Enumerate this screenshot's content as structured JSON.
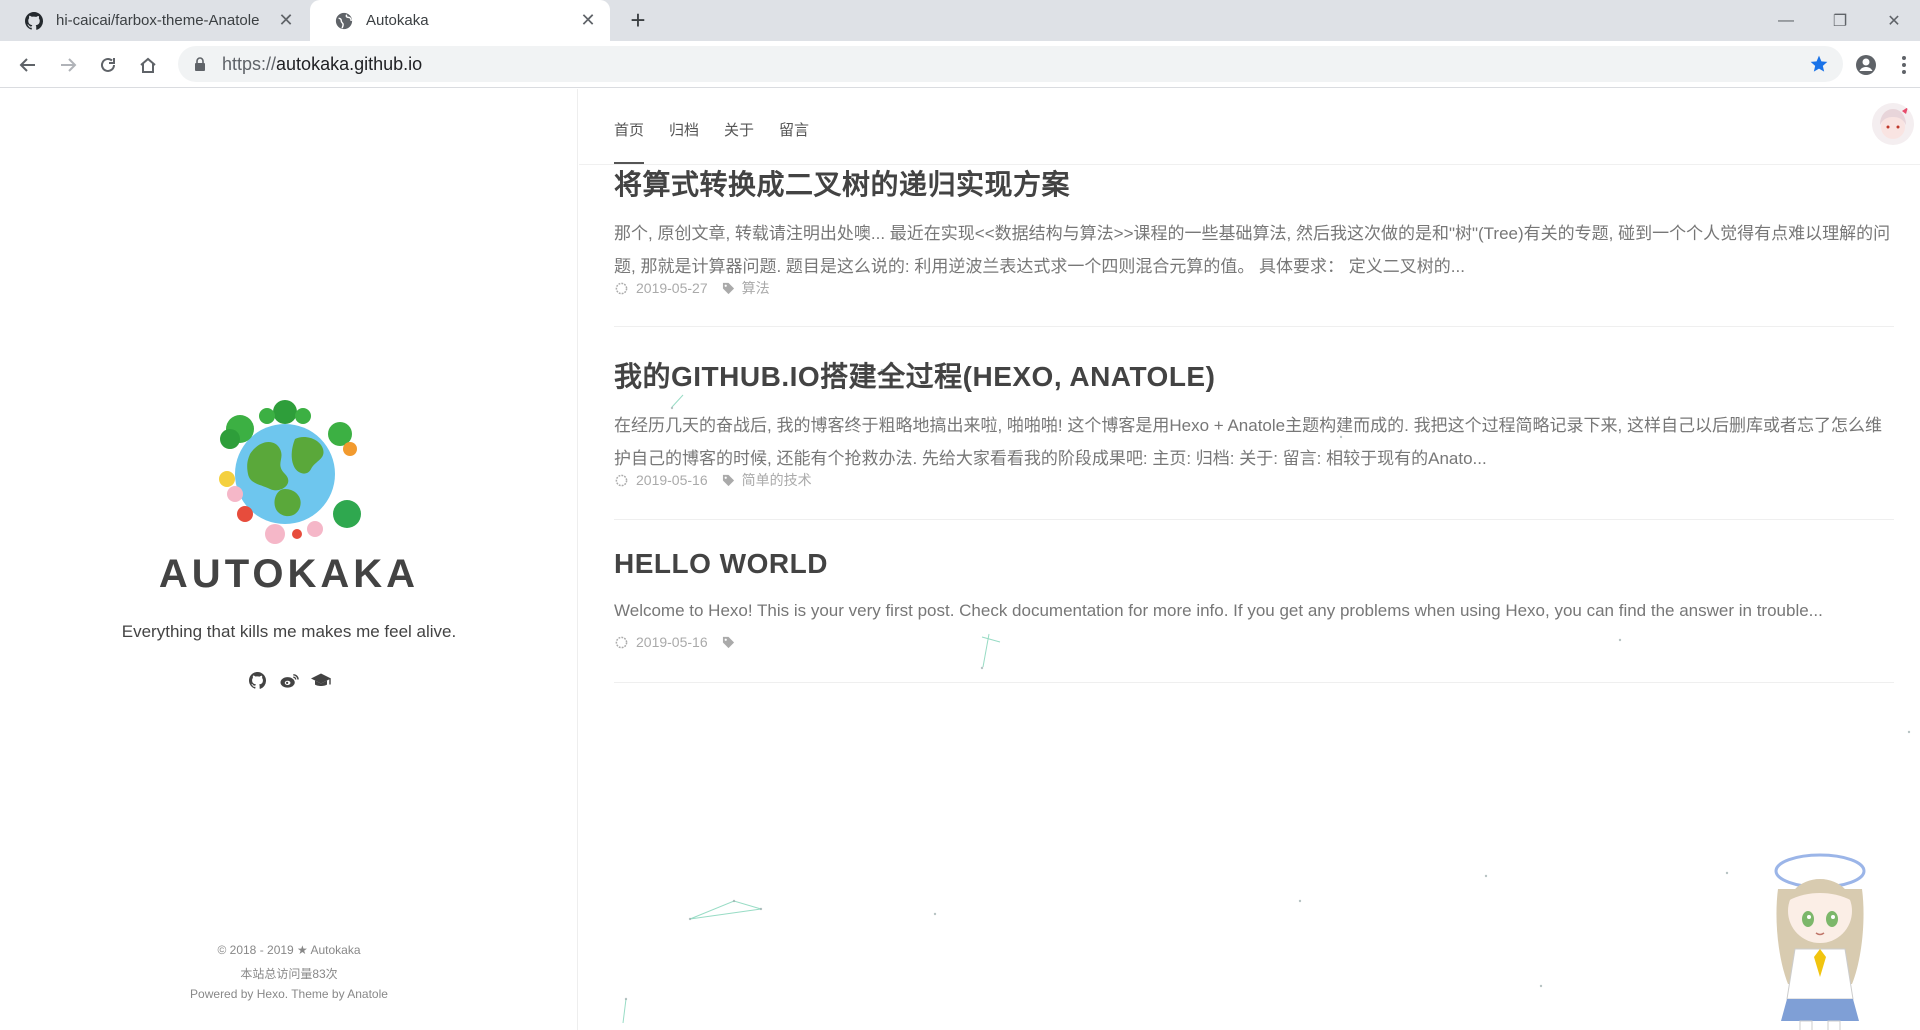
{
  "browser": {
    "tabs": [
      {
        "title": "hi-caicai/farbox-theme-Anatole",
        "icon": "github-icon"
      },
      {
        "title": "Autokaka",
        "icon": "globe-icon"
      }
    ],
    "url_scheme": "https://",
    "url_host": "autokaka.github.io"
  },
  "sidebar": {
    "title": "AUTOKAKA",
    "description": "Everything that kills me makes me feel alive.",
    "social_icons": [
      "github-icon",
      "weibo-icon",
      "graduation-cap-icon"
    ],
    "footer": {
      "copyright": "© 2018 - 2019 ★ Autokaka",
      "visits": "本站总访问量83次",
      "powered": "Powered by Hexo. Theme by Anatole"
    }
  },
  "nav": {
    "items": [
      "首页",
      "归档",
      "关于",
      "留言"
    ]
  },
  "posts": [
    {
      "title": "将算式转换成二叉树的递归实现方案",
      "excerpt": "那个, 原创文章, 转载请注明出处噢... 最近在实现<<数据结构与算法>>课程的一些基础算法, 然后我这次做的是和\"树\"(Tree)有关的专题, 碰到一个个人觉得有点难以理解的问题, 那就是计算器问题. 题目是这么说的: 利用逆波兰表达式求一个四则混合元算的值。 具体要求： 定义二叉树的...",
      "date": "2019-05-27",
      "tag": "算法"
    },
    {
      "title": "我的GITHUB.IO搭建全过程(HEXO, ANATOLE)",
      "excerpt": "在经历几天的奋战后, 我的博客终于粗略地搞出来啦, 啪啪啪! 这个博客是用Hexo + Anatole主题构建而成的. 我把这个过程简略记录下来, 这样自己以后删库或者忘了怎么维护自己的博客的时候, 还能有个抢救办法. 先给大家看看我的阶段成果吧: 主页: 归档: 关于: 留言: 相较于现有的Anato...",
      "date": "2019-05-16",
      "tag": "简单的技术"
    },
    {
      "title": "HELLO WORLD",
      "excerpt": "Welcome to Hexo! This is your very first post. Check documentation for more info. If you get any problems when using Hexo, you can find the answer in trouble...",
      "date": "2019-05-16",
      "tag": ""
    }
  ],
  "colors": {
    "text": "#434343",
    "muted": "#777777",
    "accent_star": "#1a73e8"
  }
}
